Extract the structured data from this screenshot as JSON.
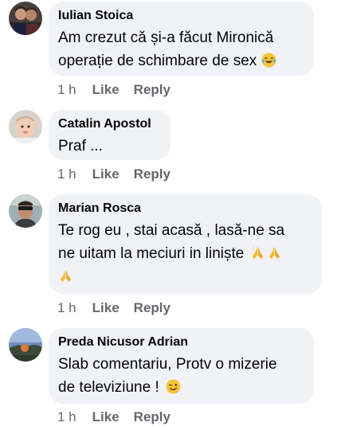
{
  "comments": [
    {
      "author": "Iulian Stoica",
      "lines": [
        "Am crezut că și-a făcut Mironică",
        "operație de schimbare de sex"
      ],
      "emoji": "tears-of-joy-emoji",
      "time": "1 h",
      "like": "Like",
      "reply": "Reply",
      "avatar": "avatar-two-people"
    },
    {
      "author": "Catalin Apostol",
      "lines": [
        "Praf ..."
      ],
      "time": "1 h",
      "like": "Like",
      "reply": "Reply",
      "avatar": "avatar-baby"
    },
    {
      "author": "Marian Rosca",
      "lines": [
        "Te rog eu , stai acasă , lasă-ne sa",
        "ne uitam la meciuri in liniște"
      ],
      "emoji": "folded-hands-emoji",
      "time": "1 h",
      "like": "Like",
      "reply": "Reply",
      "avatar": "avatar-man-sunglasses"
    },
    {
      "author": "Preda Nicusor Adrian",
      "lines": [
        "Slab comentariu, Protv o mizerie",
        "de televiziune !"
      ],
      "emoji": "winking-face-emoji",
      "time": "1 h",
      "like": "Like",
      "reply": "Reply",
      "avatar": "avatar-landscape"
    }
  ]
}
